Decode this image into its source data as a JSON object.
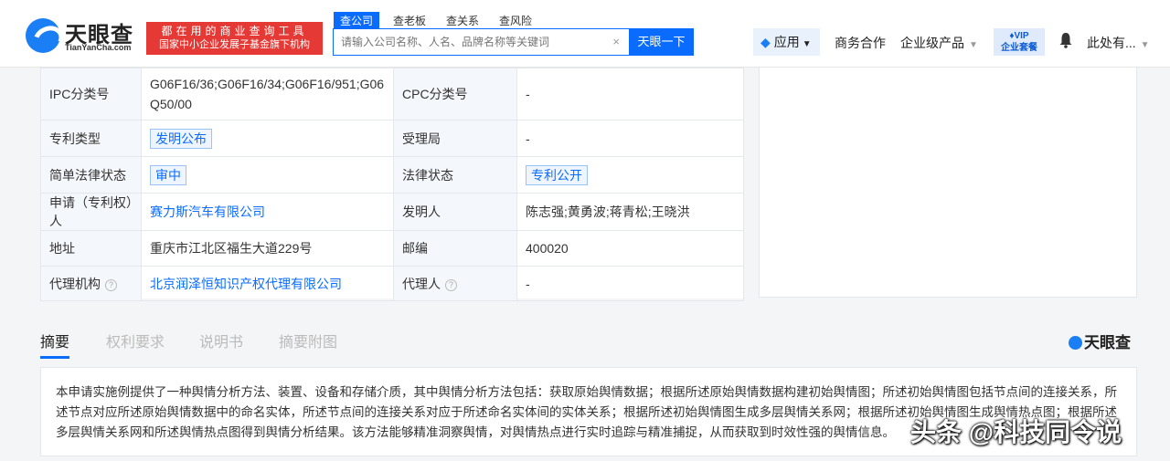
{
  "header": {
    "logo_name": "天眼查",
    "logo_sub": "TianYanCha.com",
    "promo_line1": "都在用的商业查询工具",
    "promo_line2": "国家中小企业发展子基金旗下机构",
    "search_tabs": [
      "查公司",
      "查老板",
      "查关系",
      "查风险"
    ],
    "search_placeholder": "请输入公司名称、人名、品牌名称等关键词",
    "search_clear": "×",
    "search_button": "天眼一下",
    "app_label": "应用",
    "nav": {
      "business": "商务合作",
      "enterprise": "企业级产品",
      "user": "此处有..."
    },
    "vip_line1": "VIP",
    "vip_line2": "企业套餐"
  },
  "patent": {
    "ipc_label": "IPC分类号",
    "ipc_value": "G06F16/36;G06F16/34;G06F16/951;G06Q50/00",
    "cpc_label": "CPC分类号",
    "cpc_value": "-",
    "type_label": "专利类型",
    "type_value": "发明公布",
    "office_label": "受理局",
    "office_value": "-",
    "simple_status_label": "简单法律状态",
    "simple_status_value": "审中",
    "legal_status_label": "法律状态",
    "legal_status_value": "专利公开",
    "applicant_label": "申请（专利权）人",
    "applicant_value": "赛力斯汽车有限公司",
    "inventor_label": "发明人",
    "inventor_value": "陈志强;黄勇波;蒋青松;王晓洪",
    "address_label": "地址",
    "address_value": "重庆市江北区福生大道229号",
    "postcode_label": "邮编",
    "postcode_value": "400020",
    "agency_label": "代理机构",
    "agency_value": "北京润泽恒知识产权代理有限公司",
    "agent_label": "代理人",
    "agent_value": "-"
  },
  "tabs": [
    "摘要",
    "权利要求",
    "说明书",
    "摘要附图"
  ],
  "watermark_logo": "天眼查",
  "abstract": "本申请实施例提供了一种舆情分析方法、装置、设备和存储介质，其中舆情分析方法包括：获取原始舆情数据；根据所述原始舆情数据构建初始舆情图；所述初始舆情图包括节点间的连接关系，所述节点对应所述原始舆情数据中的命名实体，所述节点间的连接关系对应于所述命名实体间的实体关系；根据所述初始舆情图生成多层舆情关系网；根据所述初始舆情图生成舆情热点图；根据所述多层舆情关系网和所述舆情热点图得到舆情分析结果。该方法能够精准洞察舆情，对舆情热点进行实时追踪与精准捕捉，从而获取到时效性强的舆情信息。",
  "overlay": "头条 @科技同令说",
  "colors": {
    "accent": "#0a6cff",
    "promo": "#e53935"
  }
}
